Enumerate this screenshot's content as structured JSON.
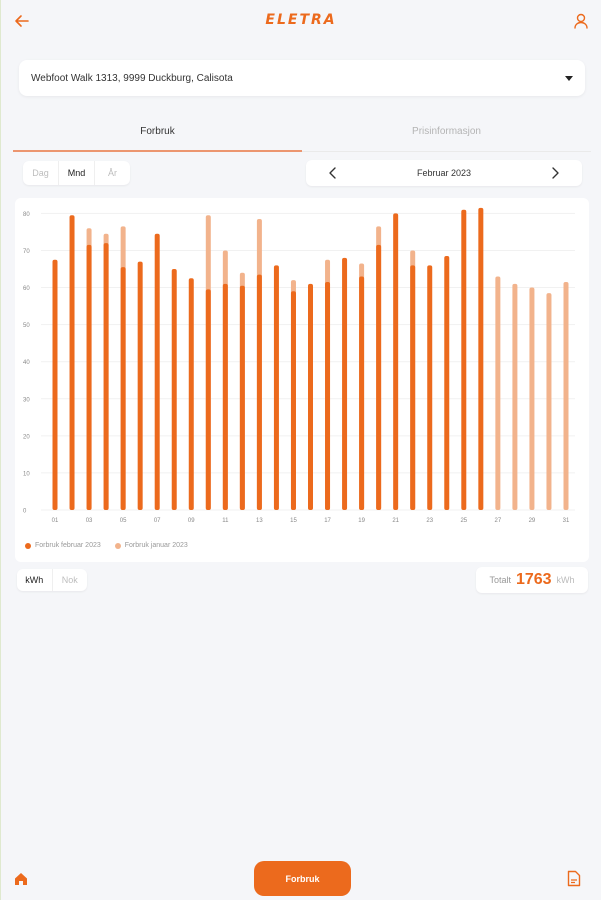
{
  "header": {
    "logo": "ELETRA",
    "icons": {
      "back": "arrow-left-icon",
      "user": "user-icon"
    }
  },
  "address": {
    "value": "Webfoot Walk 1313, 9999 Duckburg, Calisota"
  },
  "tabs": [
    {
      "label": "Forbruk",
      "active": true
    },
    {
      "label": "Prisinformasjon",
      "active": false
    }
  ],
  "period": {
    "options": [
      "Dag",
      "Mnd",
      "År"
    ],
    "selected": "Mnd"
  },
  "month_nav": {
    "label": "Februar 2023"
  },
  "unit": {
    "options": [
      "kWh",
      "Nok"
    ],
    "selected": "kWh"
  },
  "total": {
    "label": "Totalt",
    "value": "1763",
    "unit": "kWh"
  },
  "bottom": {
    "main_label": "Forbruk",
    "icons": {
      "home": "home-icon",
      "doc": "document-icon"
    }
  },
  "colors": {
    "accent": "#ec6a1d",
    "accent_light": "#f2b38c"
  },
  "chart_data": {
    "type": "bar",
    "x": [
      1,
      2,
      3,
      4,
      5,
      6,
      7,
      8,
      9,
      10,
      11,
      12,
      13,
      14,
      15,
      16,
      17,
      18,
      19,
      20,
      21,
      22,
      23,
      24,
      25,
      26,
      27,
      28,
      29,
      30,
      31
    ],
    "x_tick_labels": [
      "01",
      "03",
      "05",
      "07",
      "09",
      "11",
      "13",
      "15",
      "17",
      "19",
      "21",
      "23",
      "25",
      "27",
      "29",
      "31"
    ],
    "y_ticks": [
      0,
      10,
      20,
      30,
      40,
      50,
      60,
      70,
      80
    ],
    "ylim": [
      0,
      82
    ],
    "series": [
      {
        "name": "Forbruk februar 2023",
        "color": "#ec6a1d",
        "values": [
          67.5,
          79.5,
          71.5,
          72,
          65.5,
          67,
          74.5,
          65,
          62.5,
          59.5,
          61,
          60.5,
          63.5,
          66,
          59,
          61,
          61.5,
          68,
          63,
          71.5,
          80,
          66,
          66,
          68.5,
          81,
          81.5,
          null,
          null,
          null,
          null,
          null
        ]
      },
      {
        "name": "Forbruk januar 2023",
        "color": "#f2b38c",
        "values": [
          null,
          null,
          76,
          74.5,
          76.5,
          null,
          null,
          null,
          null,
          79.5,
          70,
          64,
          78.5,
          null,
          62,
          null,
          67.5,
          null,
          66.5,
          76.5,
          null,
          70,
          null,
          null,
          null,
          null,
          63,
          61,
          60,
          58.5,
          61.5
        ]
      }
    ]
  }
}
